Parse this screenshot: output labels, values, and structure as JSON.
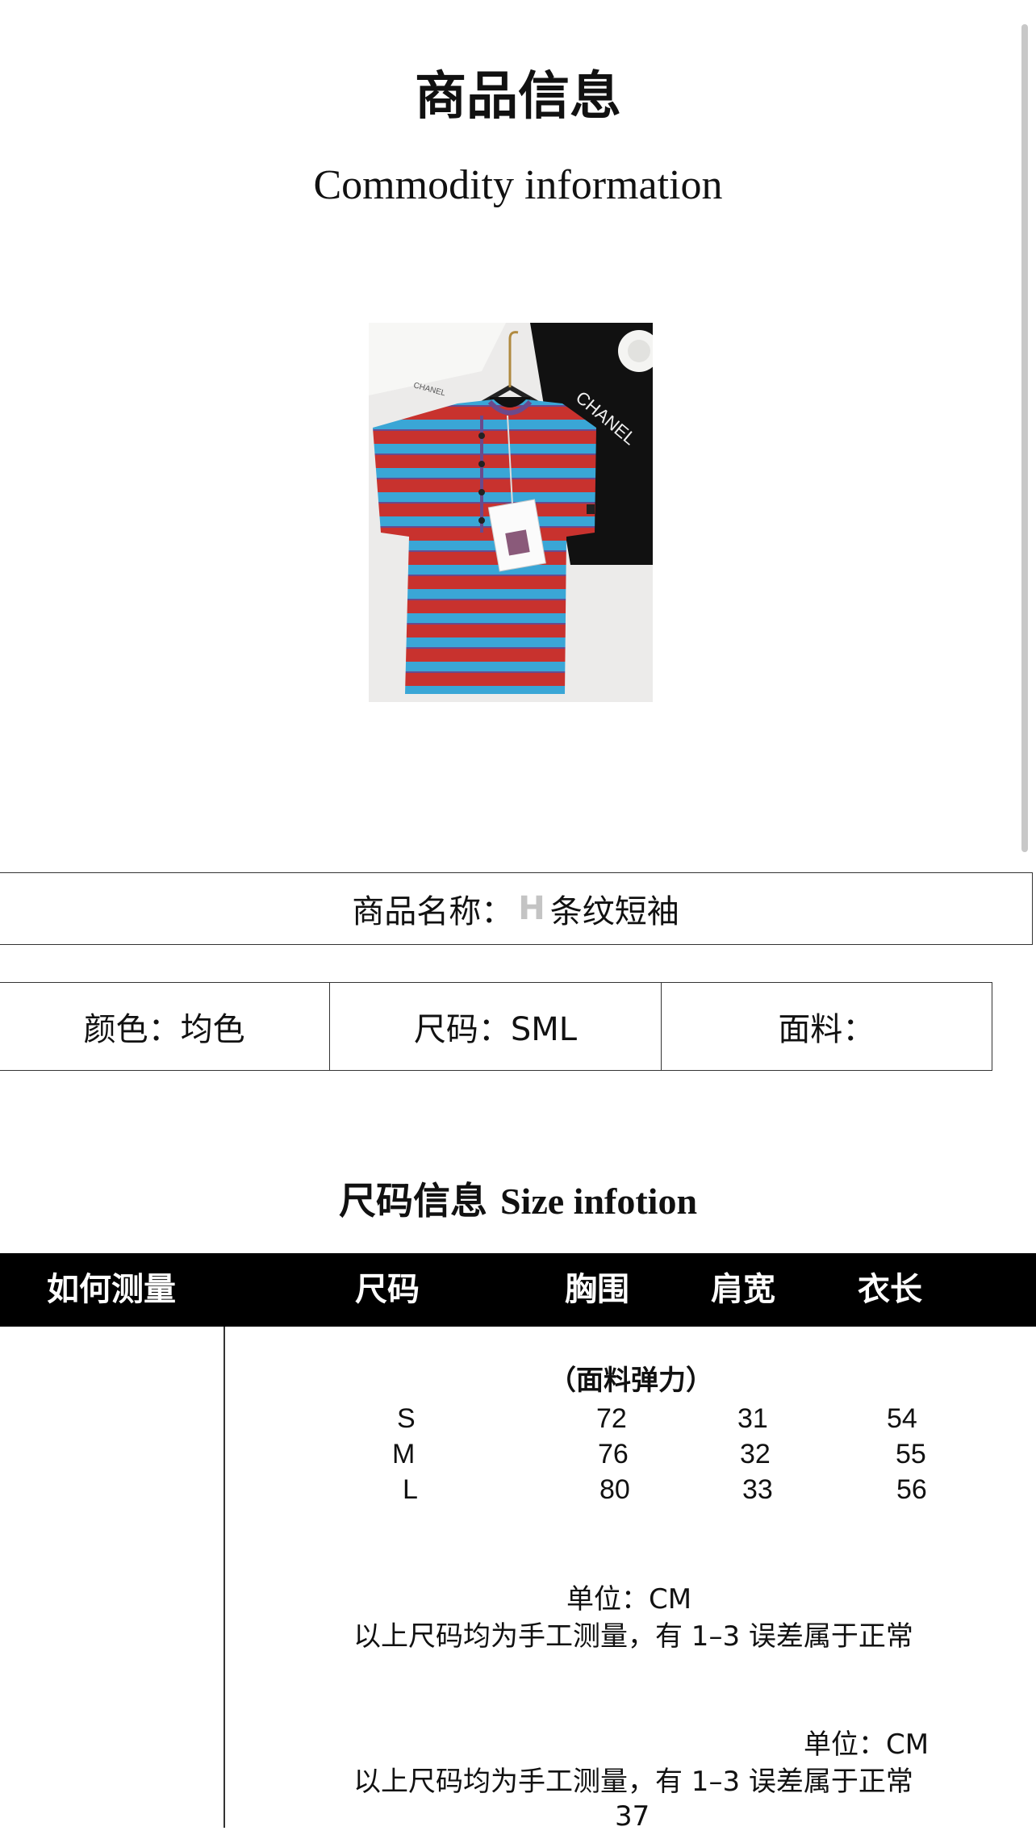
{
  "header": {
    "title_cn": "商品信息",
    "title_en": "Commodity information"
  },
  "product": {
    "name_label": "商品名称",
    "name_sep": "：",
    "name_watermark": "H",
    "name_value": "条纹短袖",
    "photo_brand_text": "CHANEL",
    "attributes": [
      {
        "label": "颜色：均色"
      },
      {
        "label": "尺码：SML"
      },
      {
        "label": "面料："
      }
    ]
  },
  "size_info": {
    "heading_cn": "尺码信息",
    "heading_en": "Size infotion",
    "columns": [
      "如何测量",
      "尺码",
      "胸围",
      "肩宽",
      "衣长"
    ],
    "elasticity_note": "（面料弹力）",
    "rows": [
      {
        "size": "S",
        "chest": "72",
        "shoulder": "31",
        "length": "54"
      },
      {
        "size": "M",
        "chest": "76",
        "shoulder": "32",
        "length": "55"
      },
      {
        "size": "L",
        "chest": "80",
        "shoulder": "33",
        "length": "56"
      }
    ],
    "unit_note_1": "单位：CM",
    "accuracy_note_1": "以上尺码均为手工测量，有 1–3 误差属于正常",
    "unit_note_2": "单位：CM",
    "accuracy_note_2": "以上尺码均为手工测量，有 1–3 误差属于正常",
    "trailing_number": "37"
  },
  "colors": {
    "stripe_red": "#c8322e",
    "stripe_blue": "#3aa6d6",
    "header_bg": "#000000"
  }
}
